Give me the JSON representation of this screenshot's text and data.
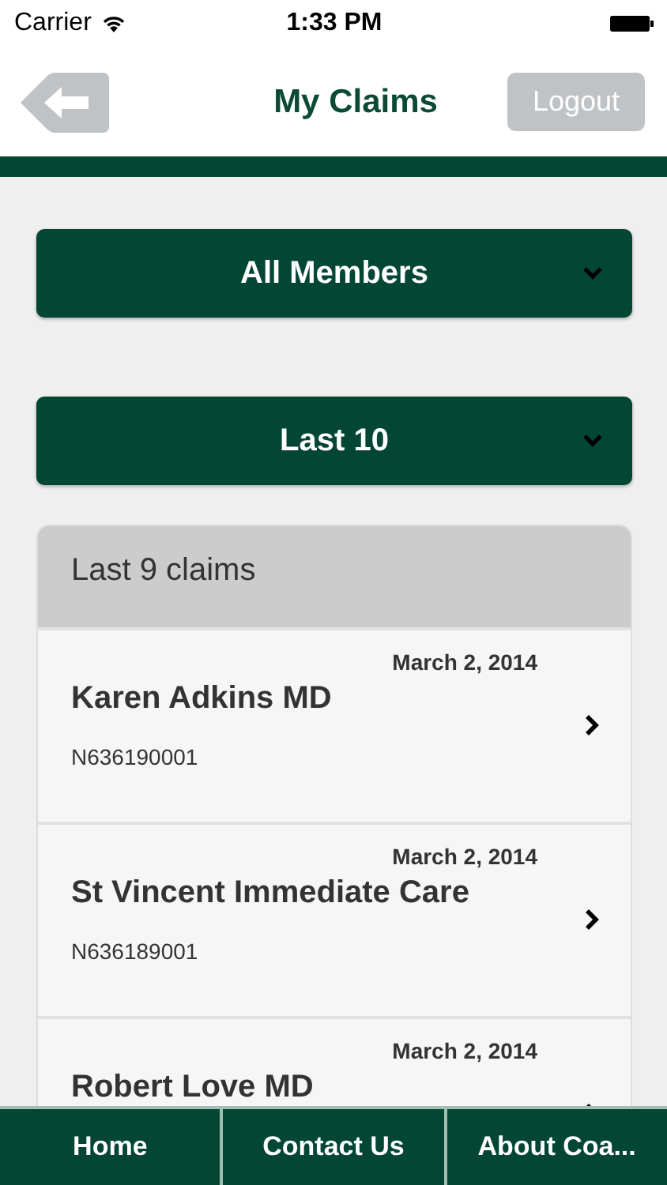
{
  "status_bar": {
    "carrier": "Carrier",
    "time": "1:33 PM"
  },
  "nav": {
    "title": "My Claims",
    "logout": "Logout"
  },
  "filters": [
    {
      "label": "All Members"
    },
    {
      "label": "Last 10"
    }
  ],
  "claims_card": {
    "header": "Last 9 claims",
    "rows": [
      {
        "date": "March 2, 2014",
        "provider": "Karen Adkins MD",
        "number": "N636190001"
      },
      {
        "date": "March 2, 2014",
        "provider": "St Vincent Immediate Care",
        "number": "N636189001"
      },
      {
        "date": "March 2, 2014",
        "provider": "Robert Love MD"
      }
    ]
  },
  "tab_bar": [
    {
      "label": "Home"
    },
    {
      "label": "Contact Us"
    },
    {
      "label": "About Coa..."
    }
  ]
}
